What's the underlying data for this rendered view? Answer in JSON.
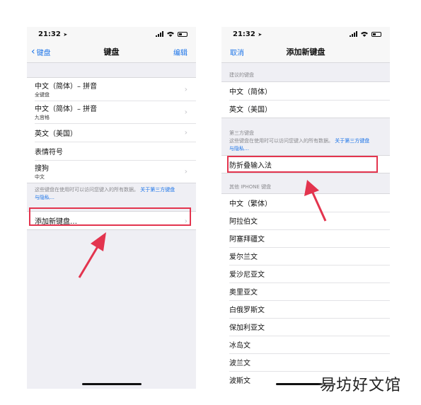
{
  "left_screen": {
    "status": {
      "time": "21:32"
    },
    "nav": {
      "back_label": "键盘",
      "title": "键盘",
      "edit_label": "编辑"
    },
    "keyboards": [
      {
        "title": "中文（简体）– 拼音",
        "subtitle": "全键盘"
      },
      {
        "title": "中文（简体）– 拼音",
        "subtitle": "九宫格"
      },
      {
        "title": "英文（美国）",
        "subtitle": ""
      },
      {
        "title": "表情符号",
        "subtitle": ""
      },
      {
        "title": "搜狗",
        "subtitle": "中文"
      }
    ],
    "privacy_note": "这些键盘在使用时可以访问您键入的所有数据。",
    "privacy_link_1": "关于第三方键盘",
    "privacy_link_2": "与隐私…",
    "add_keyboard_label": "添加新键盘…"
  },
  "right_screen": {
    "status": {
      "time": "21:32"
    },
    "nav": {
      "cancel_label": "取消",
      "title": "添加新键盘"
    },
    "suggested_header": "建议的键盘",
    "suggested": [
      "中文（简体）",
      "英文（美国）"
    ],
    "third_party_header": "第三方键盘",
    "third_party_note": "这些键盘在使用时可以访问您键入的所有数据。",
    "third_party_link_1": "关于第三方键盘",
    "third_party_link_2": "与隐私…",
    "third_party": [
      "防折叠输入法"
    ],
    "other_header": "其他 IPHONE 键盘",
    "other": [
      "中文（繁体）",
      "阿拉伯文",
      "阿塞拜疆文",
      "爱尔兰文",
      "爱沙尼亚文",
      "奥里亚文",
      "白俄罗斯文",
      "保加利亚文",
      "冰岛文",
      "波兰文",
      "波斯文"
    ]
  },
  "watermark": "易坊好文馆",
  "colors": {
    "accent": "#1a73e8",
    "highlight": "#e3344e",
    "background": "#efeff4"
  },
  "icons": [
    "location-arrow-icon",
    "signal-icon",
    "wifi-icon",
    "battery-icon",
    "chevron-left-icon",
    "chevron-right-icon",
    "red-arrow-pointer"
  ]
}
